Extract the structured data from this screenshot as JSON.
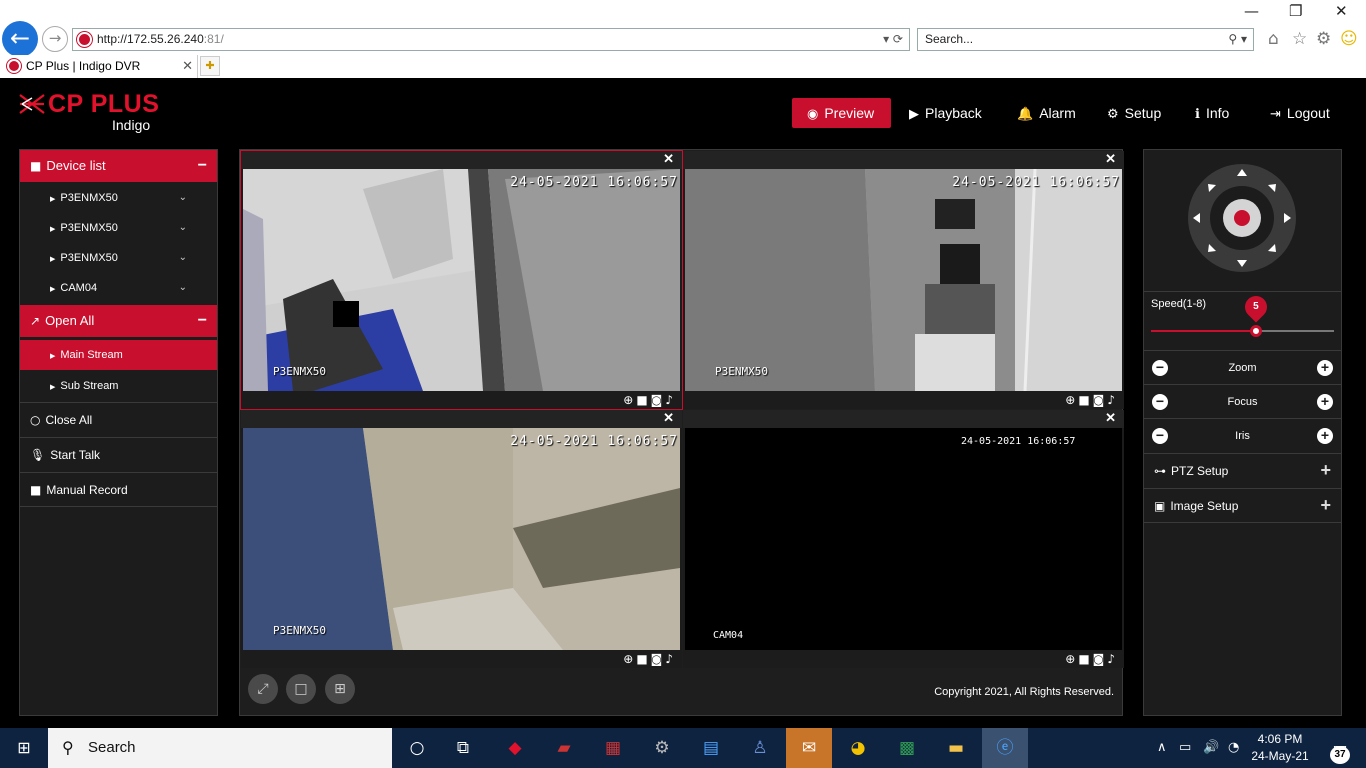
{
  "browser": {
    "url_host": "http://172.55.26.240",
    "url_port": ":81/",
    "search_placeholder": "Search...",
    "tab_title": "CP Plus | Indigo DVR"
  },
  "header": {
    "logo_brand": "CP PLUS",
    "logo_sub": "Indigo",
    "nav": [
      {
        "label": "Preview",
        "icon": "eye-icon",
        "active": true
      },
      {
        "label": "Playback",
        "icon": "play-icon"
      },
      {
        "label": "Alarm",
        "icon": "bell-icon"
      },
      {
        "label": "Setup",
        "icon": "gear-icon"
      },
      {
        "label": "Info",
        "icon": "info-icon"
      },
      {
        "label": "Logout",
        "icon": "logout-icon"
      }
    ]
  },
  "sidebar": {
    "device_list": "Device list",
    "devices": [
      "P3ENMX50",
      "P3ENMX50",
      "P3ENMX50",
      "CAM04"
    ],
    "open_all": "Open All",
    "main_stream": "Main Stream",
    "sub_stream": "Sub Stream",
    "close_all": "Close All",
    "start_talk": "Start Talk",
    "manual_record": "Manual Record"
  },
  "cameras": [
    {
      "timestamp": "24-05-2021 16:06:57",
      "name": "P3ENMX50",
      "selected": true
    },
    {
      "timestamp": "24-05-2021 16:06:57",
      "name": "P3ENMX50"
    },
    {
      "timestamp": "24-05-2021 16:06:57",
      "name": "P3ENMX50"
    },
    {
      "timestamp": "24-05-2021 16:06:57",
      "name": "CAM04"
    }
  ],
  "footer": {
    "copyright": "Copyright 2021, All Rights Reserved."
  },
  "ptz": {
    "speed_label": "Speed(1-8)",
    "speed_value": "5",
    "speed_level": 5,
    "speed_max": 8,
    "zoom": "Zoom",
    "focus": "Focus",
    "iris": "Iris",
    "ptz_setup": "PTZ Setup",
    "image_setup": "Image Setup"
  },
  "taskbar": {
    "search": "Search",
    "time": "4:06 PM",
    "date": "24-May-21",
    "notifications": "37"
  },
  "colors": {
    "accent": "#c8102e",
    "taskbar": "#0e2340"
  }
}
